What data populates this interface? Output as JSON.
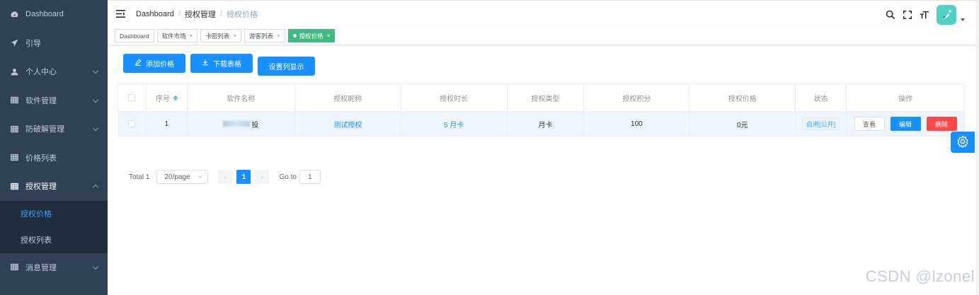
{
  "sidebar": {
    "items": [
      {
        "label": "Dashboard",
        "icon": "dashboard-icon",
        "expand": false
      },
      {
        "label": "引导",
        "icon": "send-icon",
        "expand": false
      },
      {
        "label": "个人中心",
        "icon": "user-icon",
        "expand": true
      },
      {
        "label": "软件管理",
        "icon": "table-icon",
        "expand": true
      },
      {
        "label": "防破解管理",
        "icon": "table-icon",
        "expand": true
      },
      {
        "label": "价格列表",
        "icon": "table-icon",
        "expand": false
      },
      {
        "label": "授权管理",
        "icon": "table-icon",
        "expand": true,
        "open": true
      }
    ],
    "sub_items": [
      {
        "label": "授权价格",
        "active": true
      },
      {
        "label": "授权列表",
        "active": false
      }
    ],
    "after_items": [
      {
        "label": "消息管理",
        "icon": "table-icon"
      }
    ]
  },
  "navbar": {
    "breadcrumb": [
      "Dashboard",
      "授权管理",
      "授权价格"
    ],
    "separator": "/"
  },
  "tags": [
    {
      "label": "Dashboard",
      "closable": false,
      "active": false
    },
    {
      "label": "软件市场",
      "closable": true,
      "active": false
    },
    {
      "label": "卡密列表",
      "closable": true,
      "active": false
    },
    {
      "label": "游客列表",
      "closable": true,
      "active": false
    },
    {
      "label": "授权价格",
      "closable": true,
      "active": true
    }
  ],
  "toolbar": {
    "add_label": "添加价格",
    "download_label": "下载表格",
    "columns_label": "设置列显示"
  },
  "table": {
    "headers": [
      "序号",
      "软件名称",
      "授权昵称",
      "授权时长",
      "授权类型",
      "授权积分",
      "授权价格",
      "状态",
      "操作"
    ],
    "rows": [
      {
        "index": "1",
        "software_suffix": "投",
        "nickname": "测试授权",
        "duration": "5 月卡",
        "type": "月卡",
        "points": "100",
        "price": "0元",
        "status": "启用[公开]",
        "actions": {
          "view": "查看",
          "edit": "编辑",
          "delete": "删除"
        }
      }
    ]
  },
  "pagination": {
    "total_label": "Total 1",
    "page_size": "20/page",
    "current_page": "1",
    "goto_label": "Go to",
    "goto_value": "1"
  },
  "watermark": "CSDN @lzonel",
  "colors": {
    "sidebar_bg": "#304156",
    "primary": "#1890ff",
    "active_tag": "#42b983",
    "danger": "#ff4949"
  }
}
